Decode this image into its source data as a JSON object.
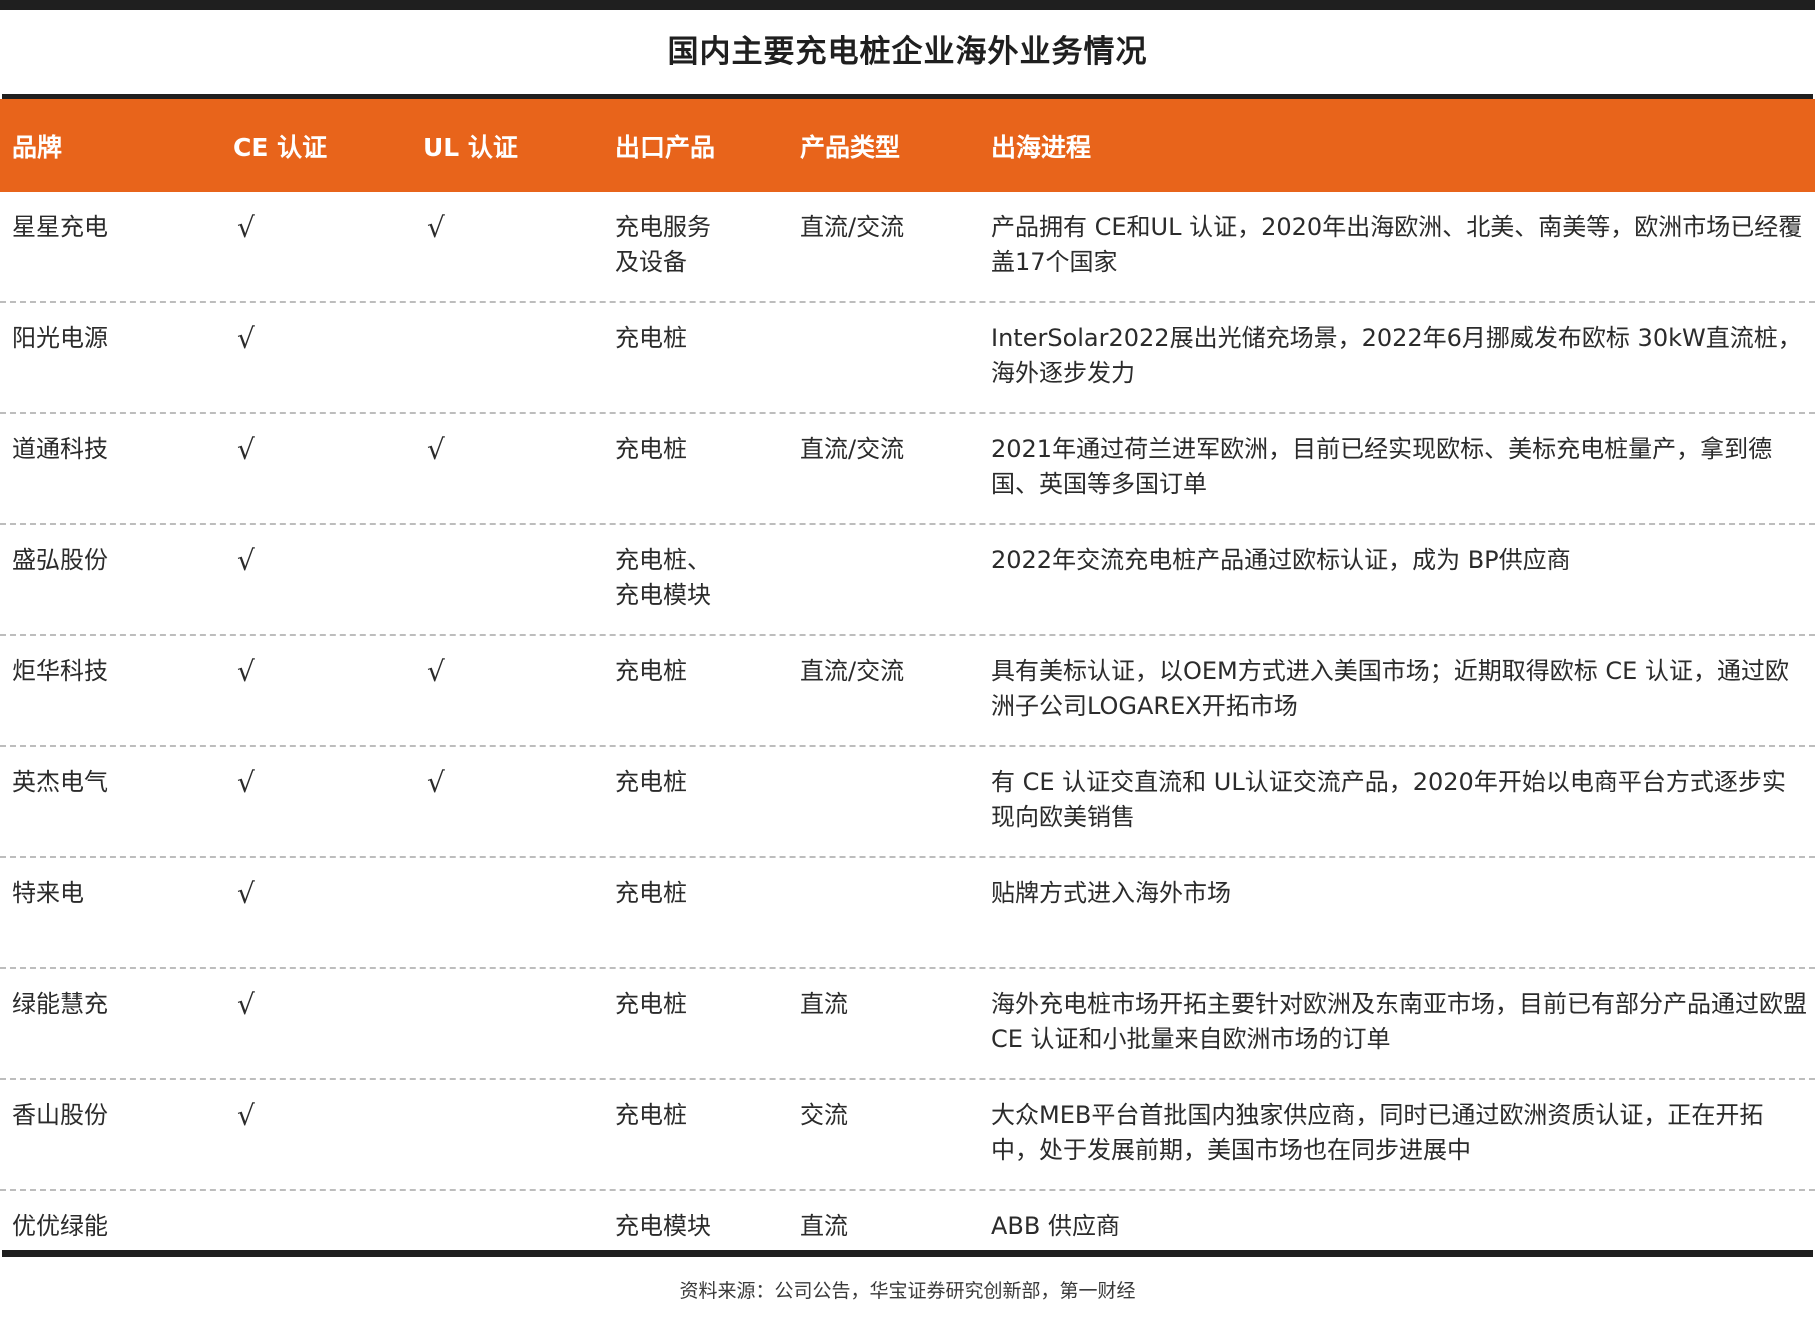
{
  "title": "国内主要充电桩企业海外业务情况",
  "header": {
    "brand": "品牌",
    "ce": "CE 认证",
    "ul": "UL 认证",
    "product": "出口产品",
    "type": "产品类型",
    "progress": "出海进程"
  },
  "rows": [
    {
      "brand": "星星充电",
      "ce": "√",
      "ul": "√",
      "product": "充电服务\n及设备",
      "type": "直流/交流",
      "progress": "产品拥有 CE和UL 认证，2020年出海欧洲、北美、南美等，欧洲市场已经覆盖17个国家"
    },
    {
      "brand": "阳光电源",
      "ce": "√",
      "ul": "",
      "product": "充电桩",
      "type": "",
      "progress": "InterSolar2022展出光储充场景，2022年6月挪威发布欧标 30kW直流桩，海外逐步发力"
    },
    {
      "brand": "道通科技",
      "ce": "√",
      "ul": "√",
      "product": "充电桩",
      "type": "直流/交流",
      "progress": "2021年通过荷兰进军欧洲，目前已经实现欧标、美标充电桩量产，拿到德国、英国等多国订单"
    },
    {
      "brand": "盛弘股份",
      "ce": "√",
      "ul": "",
      "product": "充电桩、\n充电模块",
      "type": "",
      "progress": "2022年交流充电桩产品通过欧标认证，成为 BP供应商"
    },
    {
      "brand": "炬华科技",
      "ce": "√",
      "ul": "√",
      "product": "充电桩",
      "type": "直流/交流",
      "progress": "具有美标认证，以OEM方式进入美国市场；近期取得欧标 CE 认证，通过欧洲子公司LOGAREX开拓市场"
    },
    {
      "brand": "英杰电气",
      "ce": "√",
      "ul": "√",
      "product": "充电桩",
      "type": "",
      "progress": "有 CE 认证交直流和 UL认证交流产品，2020年开始以电商平台方式逐步实现向欧美销售"
    },
    {
      "brand": "特来电",
      "ce": "√",
      "ul": "",
      "product": "充电桩",
      "type": "",
      "progress": "贴牌方式进入海外市场"
    },
    {
      "brand": "绿能慧充",
      "ce": "√",
      "ul": "",
      "product": "充电桩",
      "type": "直流",
      "progress": "海外充电桩市场开拓主要针对欧洲及东南亚市场，目前已有部分产品通过欧盟 CE 认证和小批量来自欧洲市场的订单"
    },
    {
      "brand": "香山股份",
      "ce": "√",
      "ul": "",
      "product": "充电桩",
      "type": "交流",
      "progress": "大众MEB平台首批国内独家供应商，同时已通过欧洲资质认证，正在开拓中，处于发展前期，美国市场也在同步进展中"
    },
    {
      "brand": "优优绿能",
      "ce": "",
      "ul": "",
      "product": "充电模块",
      "type": "直流",
      "progress": "ABB 供应商"
    }
  ],
  "source": "资料来源：公司公告，华宝证券研究创新部，第一财经",
  "colors": {
    "header_bg": "#e8641b",
    "rule": "#1f1f1f",
    "divider": "#bdbdbd"
  }
}
